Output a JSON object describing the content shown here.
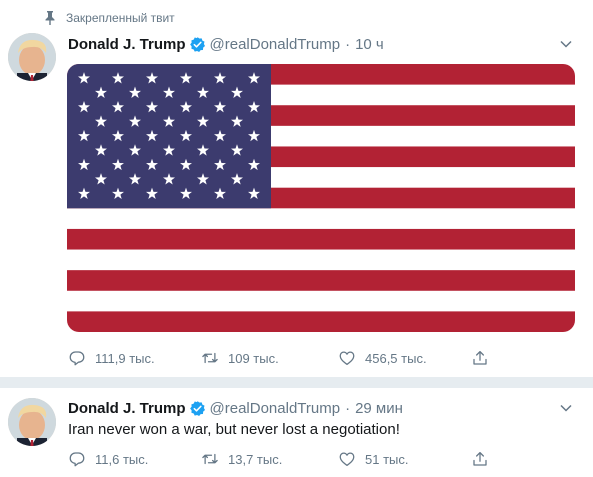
{
  "pinned_label": "Закрепленный твит",
  "tweets": [
    {
      "display_name": "Donald J. Trump",
      "screen_name": "@realDonaldTrump",
      "separator": "·",
      "time": "10 ч",
      "text": "",
      "actions": {
        "replies": "111,9 тыс.",
        "retweets": "109 тыс.",
        "likes": "456,5 тыс."
      }
    },
    {
      "display_name": "Donald J. Trump",
      "screen_name": "@realDonaldTrump",
      "separator": "·",
      "time": "29 мин",
      "text": "Iran never won a war, but never lost a negotiation!",
      "actions": {
        "replies": "11,6 тыс.",
        "retweets": "13,7 тыс.",
        "likes": "51 тыс."
      }
    }
  ],
  "colors": {
    "secondary_text": "#657786",
    "primary_text": "#14171a",
    "verified_blue": "#1da1f2",
    "divider": "#e6ecf0",
    "flag_red": "#b22234",
    "flag_blue": "#3c3b6e"
  },
  "icons": [
    "pin-icon",
    "verified-icon",
    "chevron-down-icon",
    "reply-icon",
    "retweet-icon",
    "like-icon",
    "share-icon"
  ]
}
